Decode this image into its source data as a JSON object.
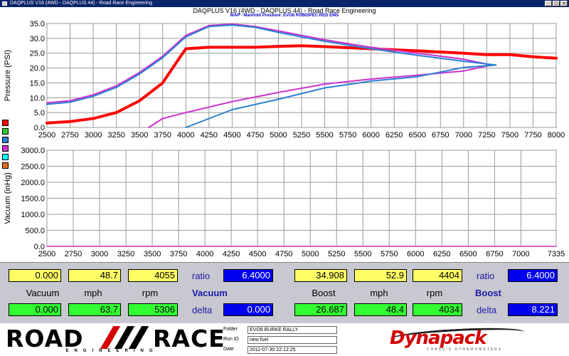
{
  "window": {
    "title": "DAQPLUS V16 (4WD - DAQPLUS 44) - Road Race Engineering",
    "buttons": [
      "_",
      "□",
      "×"
    ]
  },
  "header": {
    "title": "DAQPLUS V16 (4WD - DAQPLUS 44) - Road Race Engineering",
    "subtitle": "MAP - Manifold Pressure: EVO8 ROBISPEC RED EMS"
  },
  "legend_swatches": [
    "#ff0000",
    "#33cc33",
    "#2a7fd4",
    "#cc33cc",
    "#00ffff",
    "#e07020"
  ],
  "chart_data": [
    {
      "type": "line",
      "ylabel": "Pressure (PSI)",
      "xlim": [
        2500,
        8000
      ],
      "ylim": [
        0,
        35
      ],
      "x_ticks": [
        2500,
        2750,
        3000,
        3250,
        3500,
        3750,
        4000,
        4250,
        4500,
        4750,
        5000,
        5250,
        5500,
        5750,
        6000,
        6250,
        6500,
        6750,
        7000,
        7250,
        7500,
        7750,
        8000
      ],
      "y_ticks": [
        "0.0",
        "5.0",
        "10.0",
        "15.0",
        "20.0",
        "25.0",
        "30.0",
        "35.0"
      ],
      "grid": true,
      "series": [
        {
          "color": "#ff0000",
          "width": 4,
          "points": [
            [
              2500,
              1.5
            ],
            [
              2750,
              2
            ],
            [
              3000,
              3
            ],
            [
              3250,
              5
            ],
            [
              3500,
              9
            ],
            [
              3750,
              15
            ],
            [
              3900,
              22
            ],
            [
              4000,
              26.5
            ],
            [
              4250,
              27
            ],
            [
              4750,
              27
            ],
            [
              5000,
              27.3
            ],
            [
              5250,
              27.5
            ],
            [
              5500,
              27.2
            ],
            [
              6000,
              26.5
            ],
            [
              6500,
              25.8
            ],
            [
              7000,
              25
            ],
            [
              7250,
              24.5
            ],
            [
              7500,
              24.5
            ],
            [
              7750,
              23.8
            ],
            [
              8000,
              23.3
            ]
          ]
        },
        {
          "color": "#cc33cc",
          "width": 2,
          "points": [
            [
              2500,
              8.3
            ],
            [
              2750,
              9
            ],
            [
              3000,
              11
            ],
            [
              3250,
              14
            ],
            [
              3500,
              18.5
            ],
            [
              3750,
              24
            ],
            [
              4000,
              31
            ],
            [
              4250,
              34.3
            ],
            [
              4500,
              34.8
            ],
            [
              4750,
              34
            ],
            [
              5000,
              32.5
            ],
            [
              5500,
              29.5
            ],
            [
              6000,
              27
            ],
            [
              6500,
              25
            ],
            [
              7000,
              23
            ],
            [
              7300,
              21
            ],
            [
              7000,
              19
            ],
            [
              6500,
              17.6
            ],
            [
              6000,
              16.3
            ],
            [
              5500,
              14.6
            ],
            [
              5000,
              11.8
            ],
            [
              4500,
              8.7
            ],
            [
              4000,
              5
            ],
            [
              3750,
              3
            ],
            [
              3600,
              0
            ]
          ]
        },
        {
          "color": "#2a7fd4",
          "width": 2,
          "points": [
            [
              2500,
              7.8
            ],
            [
              2750,
              8.5
            ],
            [
              3000,
              10.5
            ],
            [
              3250,
              13.5
            ],
            [
              3500,
              18
            ],
            [
              3750,
              23.5
            ],
            [
              4000,
              30.5
            ],
            [
              4250,
              34
            ],
            [
              4500,
              34.5
            ],
            [
              4750,
              33.7
            ],
            [
              5000,
              32
            ],
            [
              5500,
              29
            ],
            [
              6000,
              26.5
            ],
            [
              6500,
              24.3
            ],
            [
              7000,
              22.3
            ],
            [
              7350,
              21
            ],
            [
              7000,
              20.2
            ],
            [
              6500,
              17.1
            ],
            [
              6000,
              15.6
            ],
            [
              5500,
              13.3
            ],
            [
              5000,
              9.5
            ],
            [
              4500,
              6
            ],
            [
              4000,
              0
            ]
          ]
        }
      ]
    },
    {
      "type": "line",
      "ylabel": "Vacuum (inHg)",
      "xlim": [
        2500,
        7335
      ],
      "ylim": [
        0,
        3000
      ],
      "x_ticks": [
        2500,
        2750,
        3000,
        3250,
        3500,
        3750,
        4000,
        4250,
        4500,
        4750,
        5000,
        5250,
        5500,
        5750,
        6000,
        6250,
        6500,
        6750,
        7000,
        7335
      ],
      "y_ticks": [
        "0.0",
        "500.0",
        "1000.0",
        "1500.0",
        "2000.0",
        "2500.0",
        "3000.0"
      ],
      "grid": true,
      "series": [
        {
          "color": "#cc33cc",
          "width": 1.5,
          "points": [
            [
              2500,
              0
            ],
            [
              7335,
              0
            ]
          ]
        }
      ]
    }
  ],
  "readouts": {
    "vacuum": {
      "top": {
        "vacuum": "0.000",
        "mph": "48.7",
        "rpm": "4055"
      },
      "bottom": {
        "vacuum": "0.000",
        "mph": "63.7",
        "rpm": "5306"
      },
      "labels": {
        "vacuum": "Vacuum",
        "mph": "mph",
        "rpm": "rpm"
      },
      "ratio_label": "ratio",
      "ratio_value": "6.4000",
      "section_label": "Vacuum",
      "delta_label": "delta",
      "delta_value": "0.000"
    },
    "boost": {
      "top": {
        "boost": "34.908",
        "mph": "52.9",
        "rpm": "4404"
      },
      "bottom": {
        "boost": "26.687",
        "mph": "48.4",
        "rpm": "4034"
      },
      "labels": {
        "boost": "Boost",
        "mph": "mph",
        "rpm": "rpm"
      },
      "ratio_label": "ratio",
      "ratio_value": "6.4000",
      "section_label": "Boost",
      "delta_label": "delta",
      "delta_value": "8.221"
    }
  },
  "footer": {
    "logo_road": "ROAD",
    "logo_race": "RACE",
    "logo_engineering": "ENGINEERING",
    "folder_label": "Folder",
    "folder_value": "EVO9 BURKE RALLY",
    "runid_label": "Run ID",
    "runid_value": "new fuel",
    "date_label": "Date",
    "date_value": "2011-07-30 22:12:25",
    "dyna_logo": "Dynapack",
    "dyna_sub": "CHASSIS DYNAMOMETERS"
  }
}
